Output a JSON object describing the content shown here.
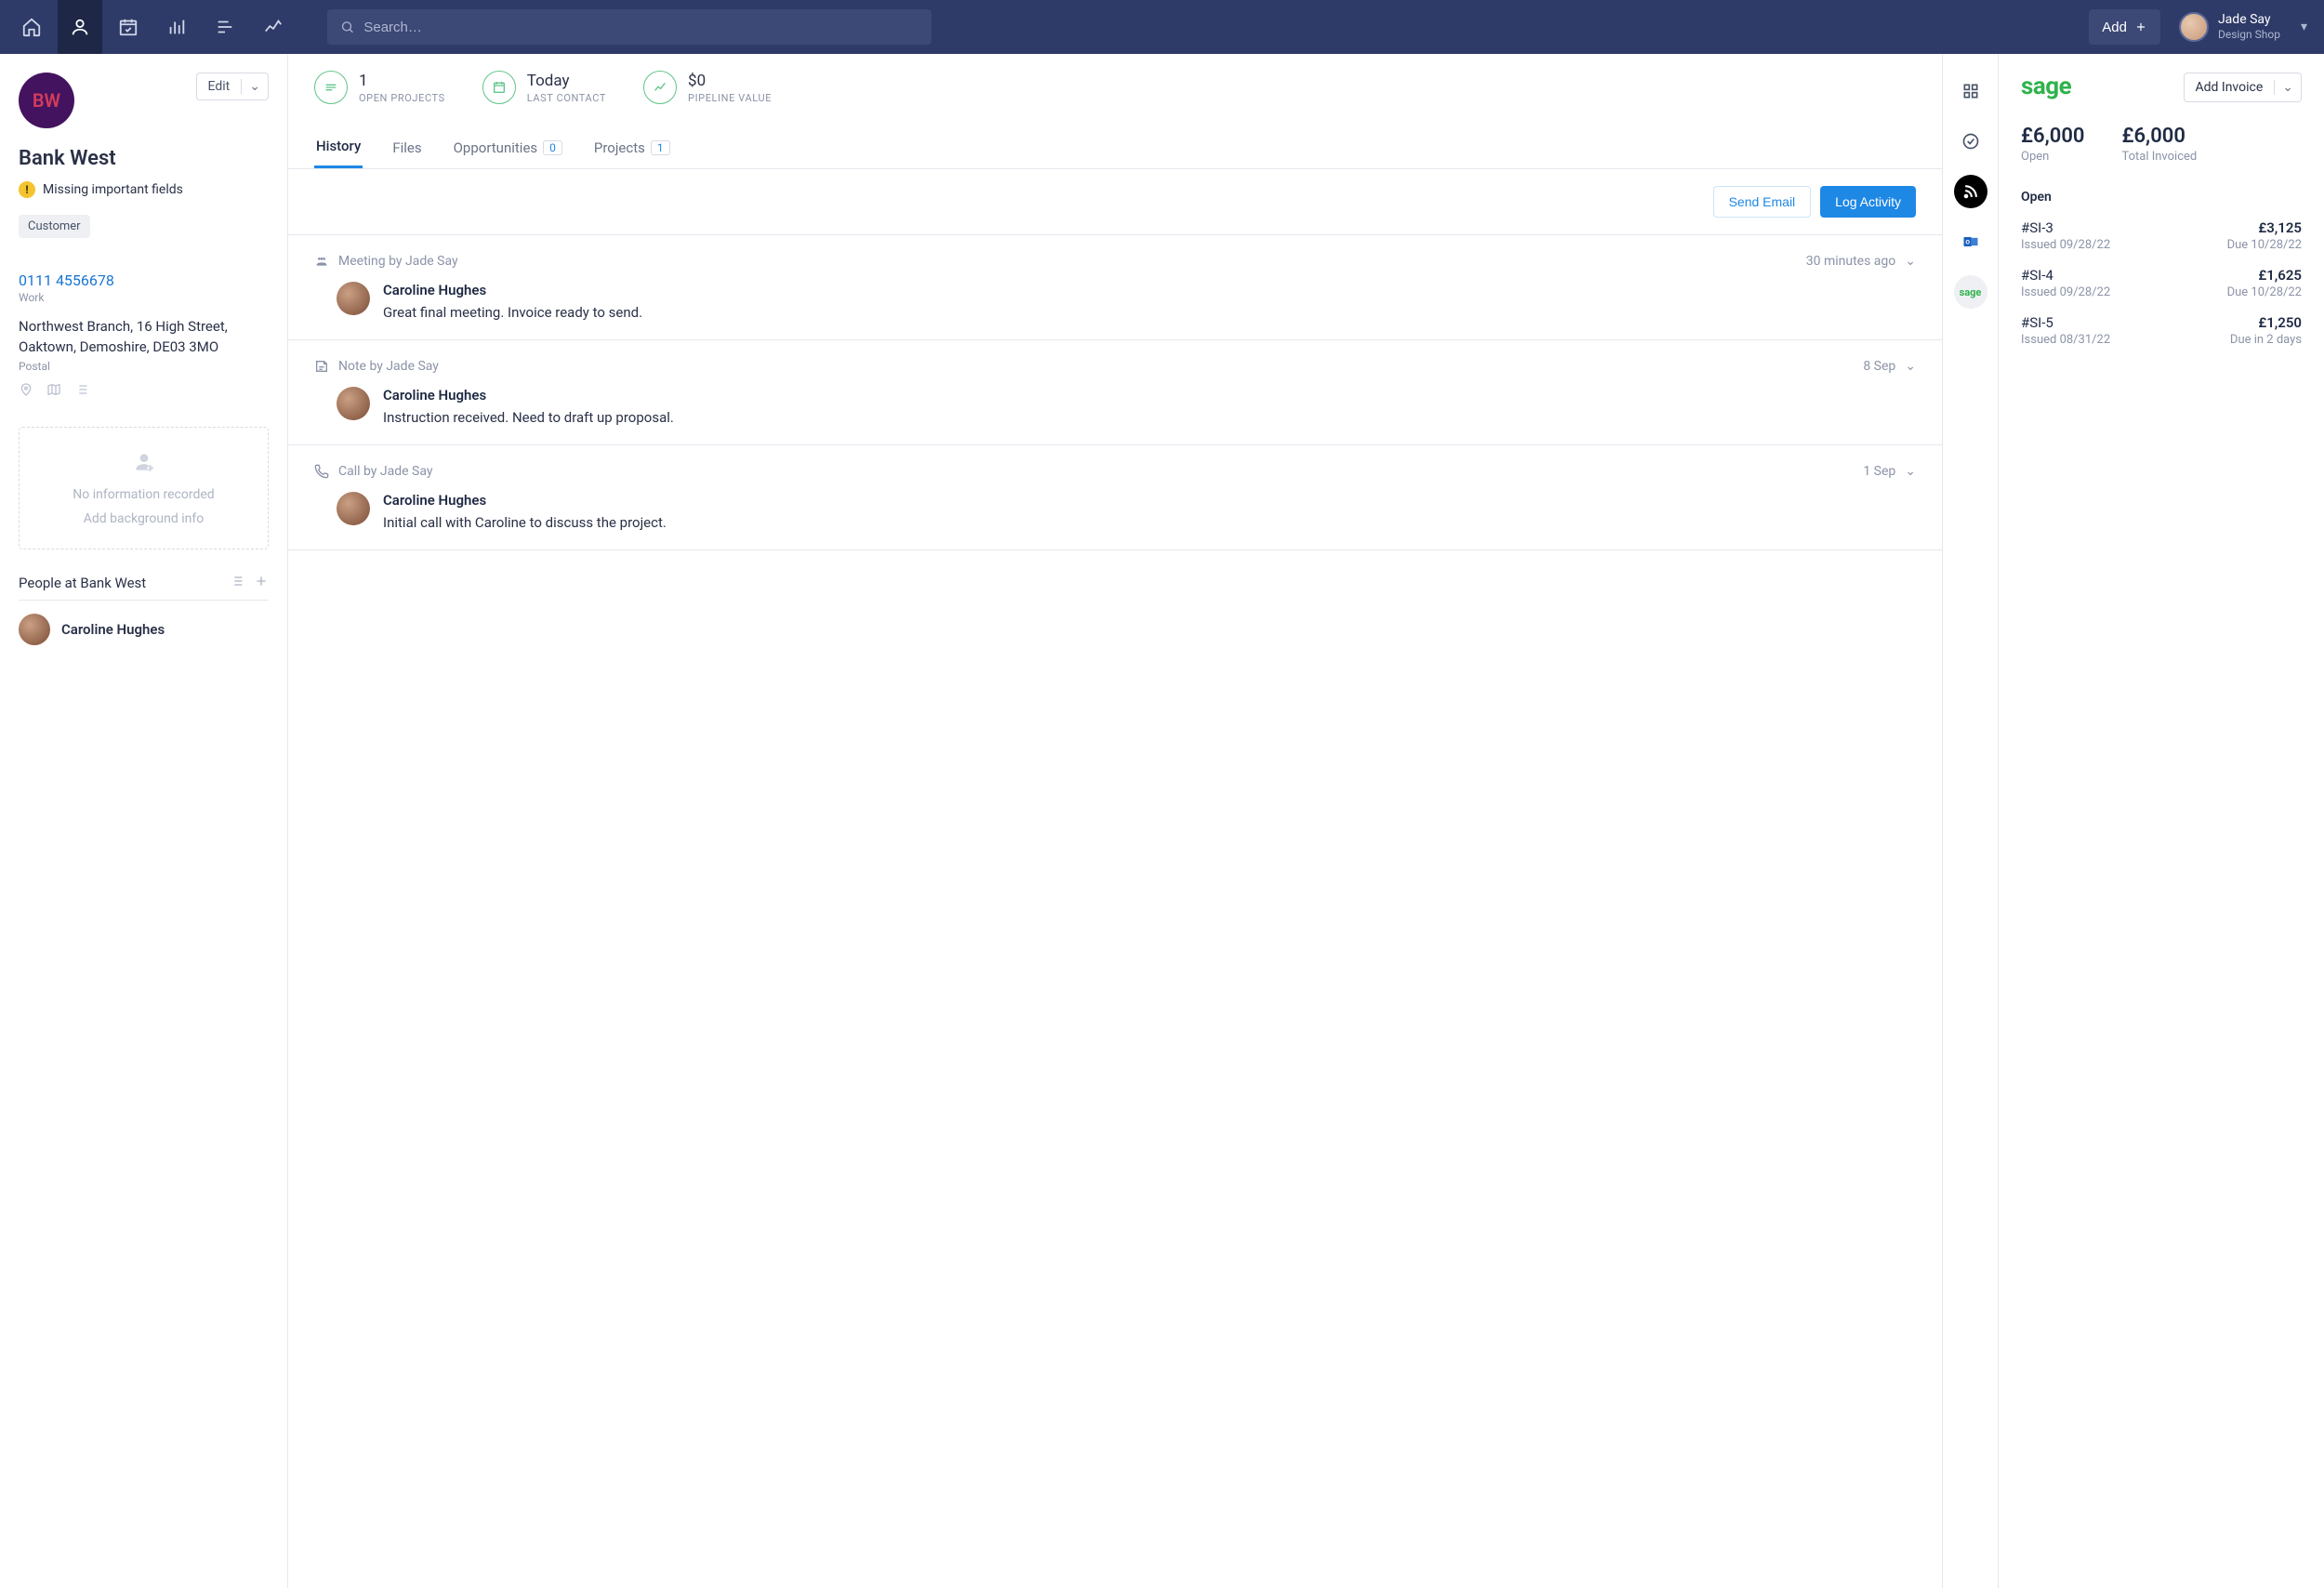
{
  "topbar": {
    "search_placeholder": "Search…",
    "add_label": "Add",
    "user_name": "Jade Say",
    "user_sub": "Design Shop"
  },
  "left": {
    "avatar_initials": "BW",
    "edit_label": "Edit",
    "org_name": "Bank West",
    "warning_text": "Missing important fields",
    "tag": "Customer",
    "phone": "0111 4556678",
    "phone_label": "Work",
    "address_line1": "Northwest Branch, 16 High Street,",
    "address_line2": "Oaktown, Demoshire, DE03 3MO",
    "address_label": "Postal",
    "placeholder_line1": "No information recorded",
    "placeholder_line2": "Add background info",
    "people_title": "People at Bank West",
    "person_name": "Caroline Hughes"
  },
  "stats": {
    "s0_val": "1",
    "s0_label": "OPEN PROJECTS",
    "s1_val": "Today",
    "s1_label": "LAST CONTACT",
    "s2_val": "$0",
    "s2_label": "PIPELINE VALUE"
  },
  "tabs": {
    "t0": "History",
    "t1": "Files",
    "t2": "Opportunities",
    "t2_count": "0",
    "t3": "Projects",
    "t3_count": "1"
  },
  "actions": {
    "send_email": "Send Email",
    "log_activity": "Log Activity"
  },
  "feed": {
    "i0_meta": "Meeting by Jade Say",
    "i0_time": "30 minutes ago",
    "i0_name": "Caroline Hughes",
    "i0_text": "Great final meeting. Invoice ready to send.",
    "i1_meta": "Note by Jade Say",
    "i1_time": "8 Sep",
    "i1_name": "Caroline Hughes",
    "i1_text": "Instruction received. Need to draft up proposal.",
    "i2_meta": "Call by Jade Say",
    "i2_time": "1 Sep",
    "i2_name": "Caroline Hughes",
    "i2_text": "Initial call with Caroline to discuss the project."
  },
  "right": {
    "logo": "sage",
    "add_invoice": "Add Invoice",
    "open_val": "£6,000",
    "open_label": "Open",
    "total_val": "£6,000",
    "total_label": "Total Invoiced",
    "section": "Open",
    "r0_id": "#SI-3",
    "r0_amt": "£3,125",
    "r0_issued": "Issued 09/28/22",
    "r0_due": "Due 10/28/22",
    "r1_id": "#SI-4",
    "r1_amt": "£1,625",
    "r1_issued": "Issued 09/28/22",
    "r1_due": "Due 10/28/22",
    "r2_id": "#SI-5",
    "r2_amt": "£1,250",
    "r2_issued": "Issued 08/31/22",
    "r2_due": "Due in 2 days"
  }
}
